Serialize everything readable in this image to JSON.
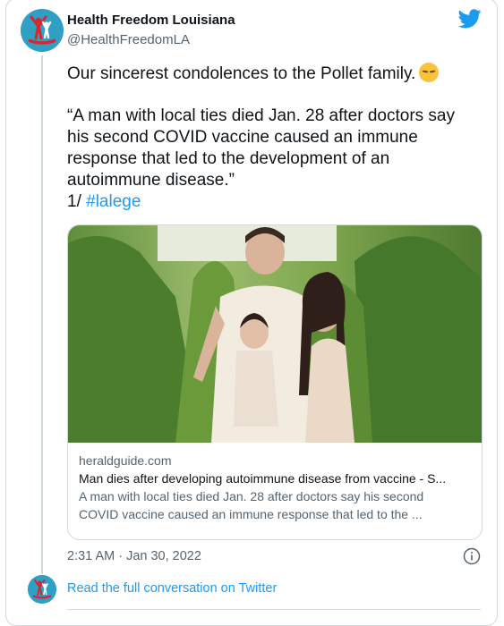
{
  "tweet": {
    "author_name": "Health Freedom Louisiana",
    "author_handle": "@HealthFreedomLA",
    "text_line1": "Our sincerest condolences to the Pollet family.",
    "emoji": "pensive-face",
    "quote": "“A man with local ties died Jan. 28 after doctors say his second COVID vaccine caused an immune response that led to the development of an autoimmune disease.”",
    "thread_prefix": "1/",
    "hashtag": "#lalege",
    "timestamp": "2:31 AM · Jan 30, 2022"
  },
  "link_card": {
    "domain": "heraldguide.com",
    "title": "Man dies after developing autoimmune disease from vaccine - S...",
    "description_line1": "A man with local ties died Jan. 28 after doctors say his second",
    "description_line2": "COVID vaccine caused an immune response that led to the ..."
  },
  "footer": {
    "read_more": "Read the full conversation on Twitter"
  },
  "colors": {
    "accent": "#1d9bf0",
    "secondary_text": "#536471",
    "border": "#cfd9de"
  },
  "icons": [
    "twitter-bird-icon",
    "info-icon",
    "pensive-face-emoji"
  ]
}
